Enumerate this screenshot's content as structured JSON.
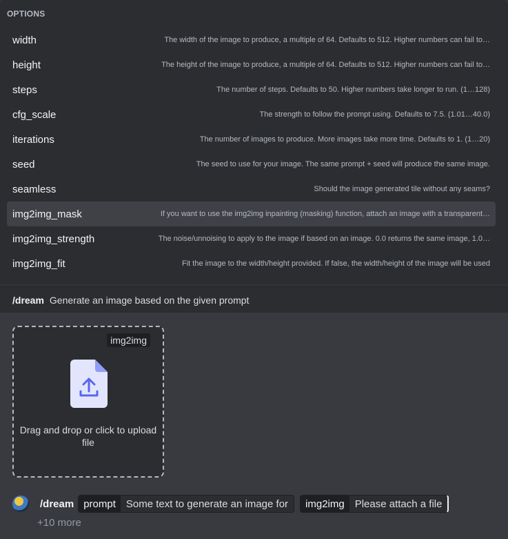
{
  "options": {
    "header": "OPTIONS",
    "items": [
      {
        "name": "width",
        "desc": "The width of the image to produce, a multiple of 64. Defaults to 512. Higher numbers can fail to…"
      },
      {
        "name": "height",
        "desc": "The height of the image to produce, a multiple of 64. Defaults to 512. Higher numbers can fail to…"
      },
      {
        "name": "steps",
        "desc": "The number of steps. Defaults to 50. Higher numbers take longer to run. (1…128)"
      },
      {
        "name": "cfg_scale",
        "desc": "The strength to follow the prompt using. Defaults to 7.5. (1.01…40.0)"
      },
      {
        "name": "iterations",
        "desc": "The number of images to produce. More images take more time. Defaults to 1. (1…20)"
      },
      {
        "name": "seed",
        "desc": "The seed to use for your image. The same prompt + seed will produce the same image."
      },
      {
        "name": "seamless",
        "desc": "Should the image generated tile without any seams?"
      },
      {
        "name": "img2img_mask",
        "desc": "If you want to use the img2img inpainting (masking) function, attach an image with a transparent…"
      },
      {
        "name": "img2img_strength",
        "desc": "The noise/unnoising to apply to the image if based on an image. 0.0 returns the same image, 1.0…"
      },
      {
        "name": "img2img_fit",
        "desc": "Fit the image to the width/height provided. If false, the width/height of the image will be used"
      }
    ],
    "active_index": 7
  },
  "command": {
    "name": "/dream",
    "description": "Generate an image based on the given prompt"
  },
  "upload": {
    "tag": "img2img",
    "text": "Drag and drop or click to upload file",
    "icon": "file-upload-icon"
  },
  "bar": {
    "command": "/dream",
    "params": [
      {
        "key": "prompt",
        "value": "Some text to generate an image for"
      },
      {
        "key": "img2img",
        "value": "Please attach a file"
      }
    ],
    "more": "+10 more"
  },
  "colors": {
    "panel": "#2b2d31",
    "main": "#383a40",
    "accent": "#949cf7",
    "text": "#f2f3f5"
  }
}
